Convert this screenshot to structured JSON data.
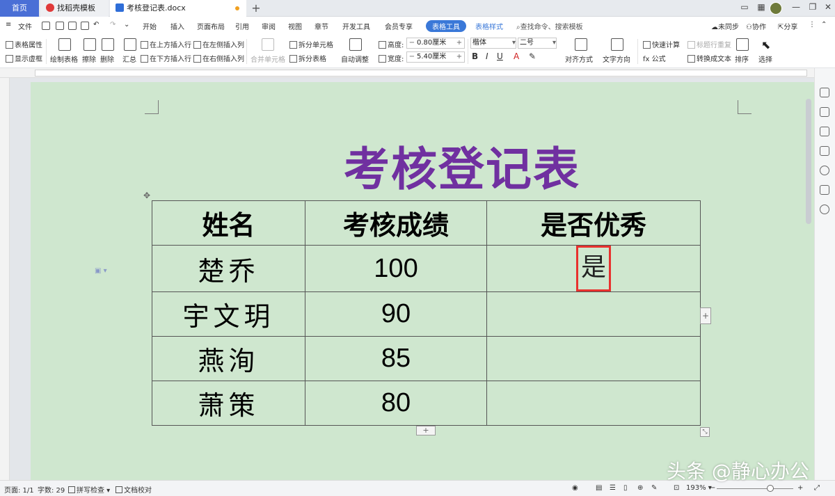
{
  "tabs": {
    "home": "首页",
    "template": "找稻壳模板",
    "document": "考核登记表.docx"
  },
  "menu": {
    "file": "文件",
    "items": [
      "开始",
      "插入",
      "页面布局",
      "引用",
      "审阅",
      "视图",
      "章节",
      "开发工具",
      "会员专享"
    ],
    "table_tools": "表格工具",
    "table_style": "表格样式",
    "search": "查找命令、搜索模板",
    "sync": "未同步",
    "collab": "协作",
    "share": "分享"
  },
  "ribbon": {
    "table_props": "表格属性",
    "show_gridlines": "显示虚框",
    "draw_table": "绘制表格",
    "erase": "擦除",
    "delete": "删除",
    "summary": "汇总",
    "insert_above": "在上方插入行",
    "insert_below": "在下方插入行",
    "insert_left": "在左侧插入列",
    "insert_right": "在右侧插入列",
    "merge_cells": "合并单元格",
    "split_cells": "拆分单元格",
    "split_table": "拆分表格",
    "auto_fit": "自动调整",
    "height_label": "高度:",
    "height_value": "0.80厘米",
    "width_label": "宽度:",
    "width_value": "5.40厘米",
    "font_name": "楷体",
    "font_size": "二号",
    "align": "对齐方式",
    "text_direction": "文字方向",
    "quick_calc": "快速计算",
    "repeat_header": "标题行重复",
    "formula": "公式",
    "convert_text": "转换成文本",
    "sort": "排序",
    "select": "选择"
  },
  "document": {
    "title": "考核登记表",
    "headers": [
      "姓名",
      "考核成绩",
      "是否优秀"
    ],
    "rows": [
      {
        "name": "楚乔",
        "score": "100",
        "excellent": "是"
      },
      {
        "name": "宇文玥",
        "score": "90",
        "excellent": ""
      },
      {
        "name": "燕洵",
        "score": "85",
        "excellent": ""
      },
      {
        "name": "萧策",
        "score": "80",
        "excellent": ""
      }
    ],
    "title_color": "#7030a0",
    "page_color": "#cfe7cf",
    "highlight_color": "#e8312e"
  },
  "status": {
    "page": "页面: 1/1",
    "word_count": "字数: 29",
    "spell_check": "拼写检查",
    "doc_proof": "文档校对",
    "zoom": "193%"
  },
  "watermark": "头条 @静心办公"
}
